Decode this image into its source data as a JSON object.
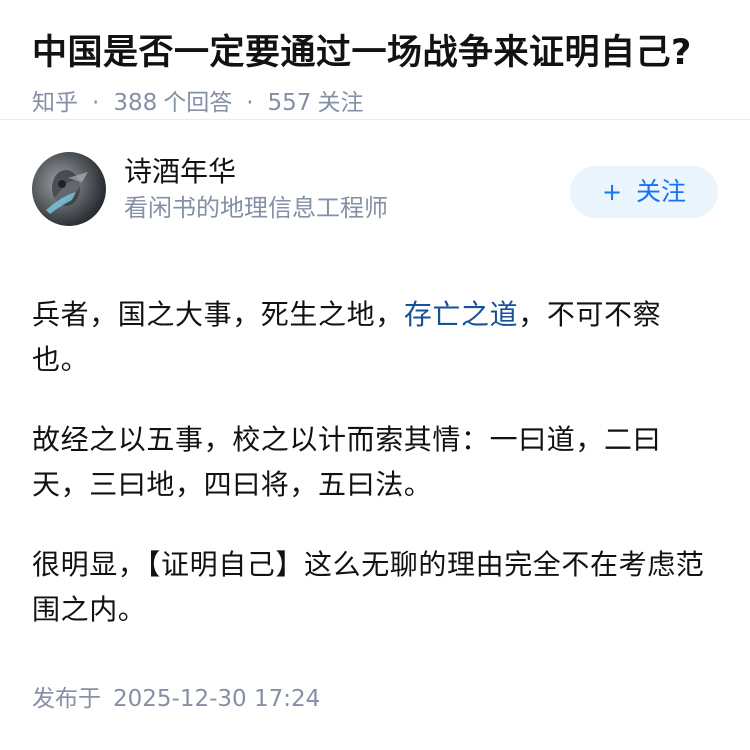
{
  "question": {
    "title": "中国是否一定要通过一场战争来证明自己?",
    "source": "知乎",
    "answer_count": "388",
    "answer_label": "个回答",
    "follow_count": "557",
    "follow_label": "关注",
    "separator": "·"
  },
  "author": {
    "avatar_icon": "avatar-image",
    "name": "诗酒年华",
    "bio": "看闲书的地理信息工程师",
    "follow_button": {
      "plus": "+",
      "label": "关注"
    }
  },
  "answer": {
    "paragraphs": [
      {
        "before": "兵者，国之大事，死生之地，",
        "link": "存亡之道",
        "after": "，不可不察也。"
      },
      {
        "text": "故经之以五事，校之以计而索其情：一曰道，二曰天，三曰地，四曰将，五曰法。"
      },
      {
        "text": "很明显，【证明自己】这么无聊的理由完全不在考虑范围之内。"
      }
    ],
    "published_label": "发布于",
    "published_time": "2025-12-30 17:24"
  },
  "colors": {
    "link": "#175199",
    "accent": "#1772f6",
    "meta": "#8590a6",
    "follow_bg": "#ebf5fd"
  }
}
